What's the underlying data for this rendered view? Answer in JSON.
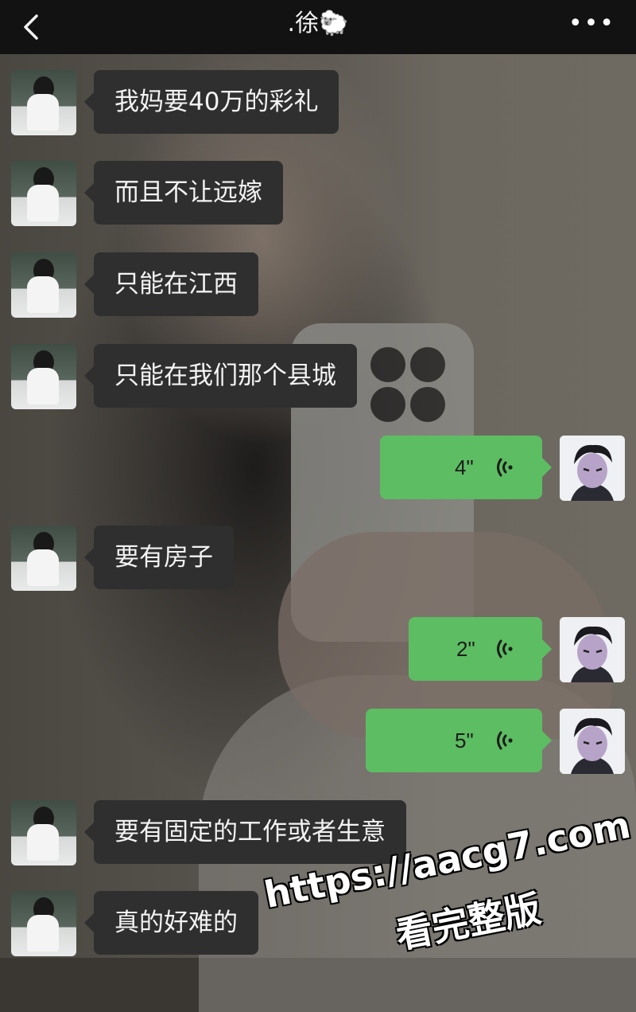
{
  "header": {
    "title": ".徐🐑",
    "back_icon": "chevron-left-icon",
    "more_label": "•••"
  },
  "messages": [
    {
      "side": "left",
      "text": "我妈要40万的彩礼"
    },
    {
      "side": "left",
      "text": "而且不让远嫁"
    },
    {
      "side": "left",
      "text": "只能在江西"
    },
    {
      "side": "left",
      "text": "只能在我们那个县城"
    },
    {
      "side": "right",
      "type": "voice",
      "duration": "4\""
    },
    {
      "side": "left",
      "text": "要有房子"
    },
    {
      "side": "right",
      "type": "voice",
      "duration": "2\""
    },
    {
      "side": "right",
      "type": "voice",
      "duration": "5\""
    },
    {
      "side": "left",
      "text": "要有固定的工作或者生意"
    },
    {
      "side": "left",
      "text": "真的好难的"
    }
  ],
  "watermark": {
    "line1": "https://aacg7.com",
    "line2": "看完整版"
  },
  "colors": {
    "incoming_bubble": "#2f2f2f",
    "outgoing_bubble": "#5dbd62",
    "topbar": "#121212"
  }
}
